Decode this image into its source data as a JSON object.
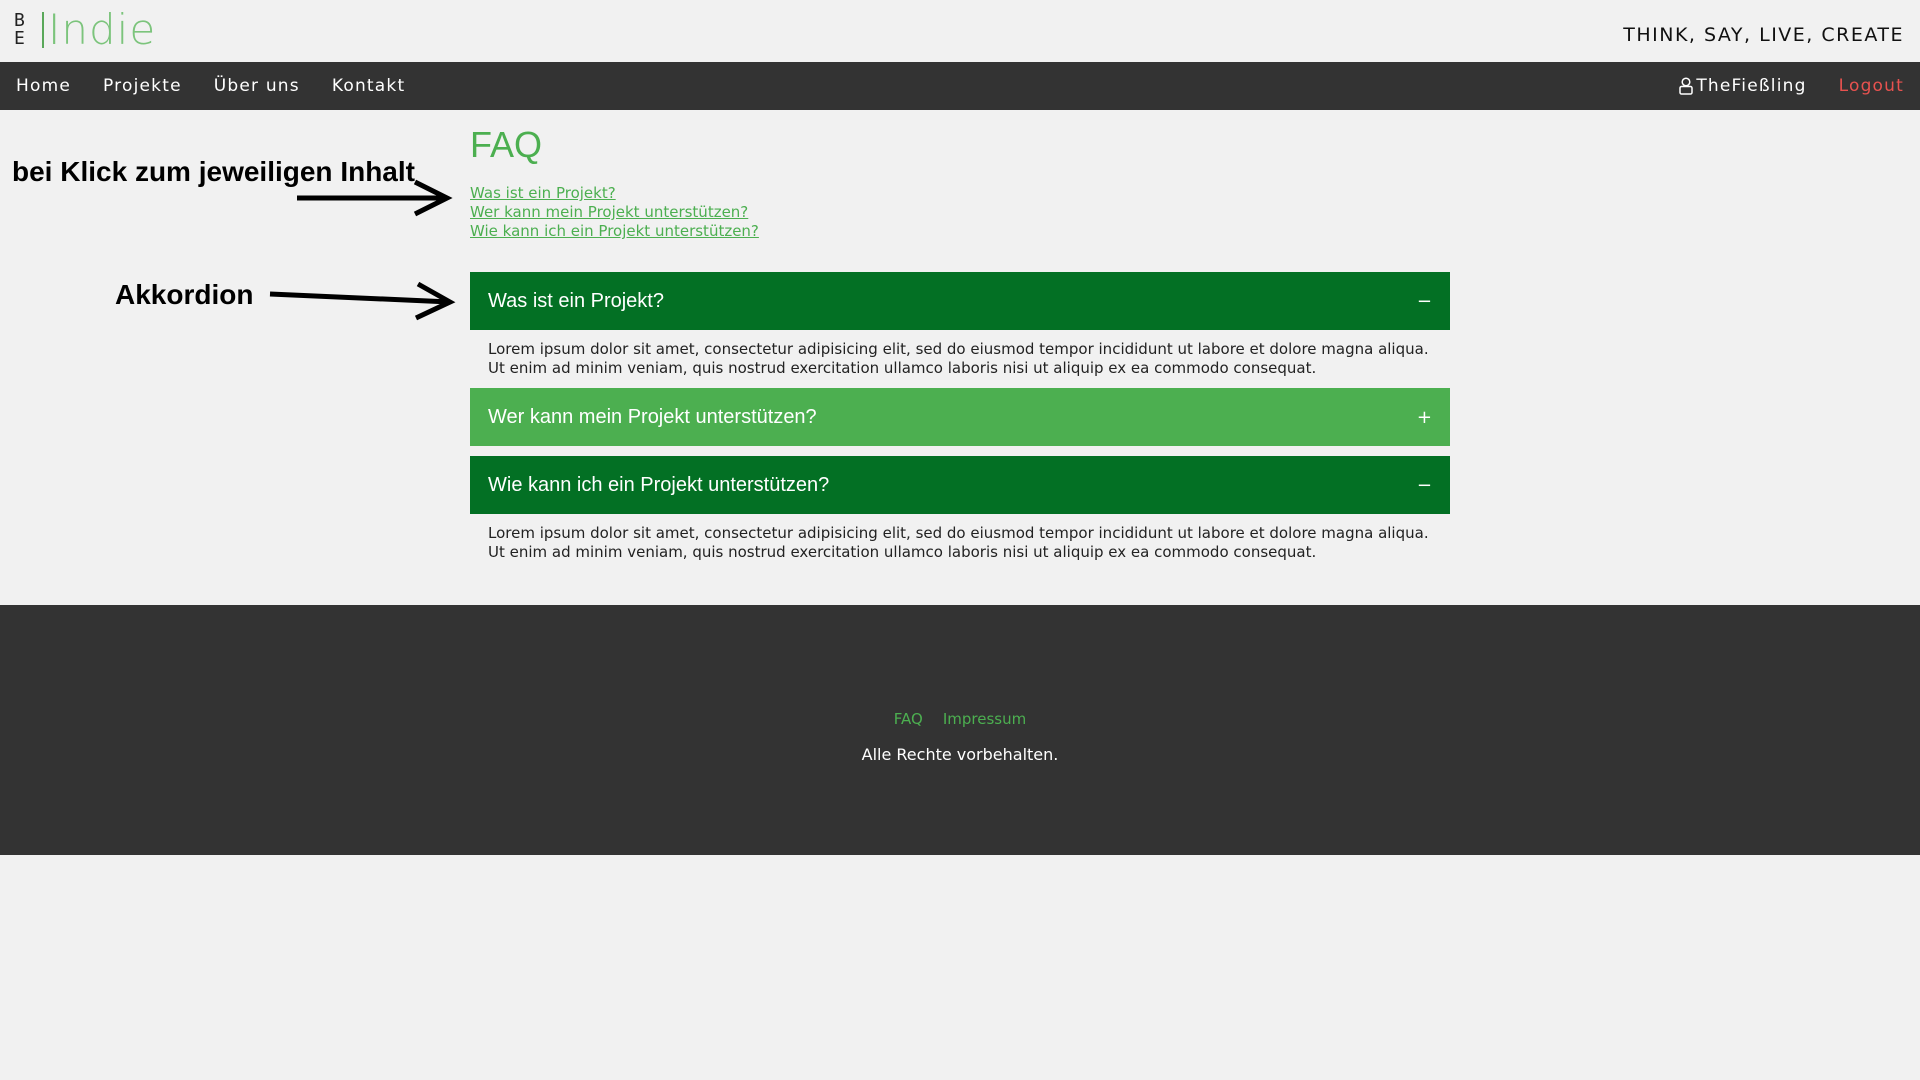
{
  "header": {
    "logo_be_top": "B",
    "logo_be_bottom": "E",
    "logo_text": "Indie",
    "tagline": "THINK, SAY, LIVE, CREATE"
  },
  "nav": {
    "items": [
      {
        "label": "Home"
      },
      {
        "label": "Projekte"
      },
      {
        "label": "Über uns"
      },
      {
        "label": "Kontakt"
      }
    ],
    "user": "TheFießling",
    "user_icon": "user-icon",
    "logout": "Logout"
  },
  "annotations": {
    "links_note": "bei Klick zum jeweiligen Inhalt",
    "accordion_note": "Akkordion"
  },
  "main": {
    "title": "FAQ",
    "quick_links": [
      "Was ist ein Projekt?",
      "Wer kann mein Projekt unterstützen?",
      "Wie kann ich ein Projekt unterstützen?"
    ],
    "accordion": [
      {
        "title": "Was ist ein Projekt?",
        "state": "open",
        "sign": "−",
        "body": "Lorem ipsum dolor sit amet, consectetur adipisicing elit, sed do eiusmod tempor incididunt ut labore et dolore magna aliqua. Ut enim ad minim veniam, quis nostrud exercitation ullamco laboris nisi ut aliquip ex ea commodo consequat."
      },
      {
        "title": "Wer kann mein Projekt unterstützen?",
        "state": "closed",
        "sign": "+",
        "body": ""
      },
      {
        "title": "Wie kann ich ein Projekt unterstützen?",
        "state": "open",
        "sign": "−",
        "body": "Lorem ipsum dolor sit amet, consectetur adipisicing elit, sed do eiusmod tempor incididunt ut labore et dolore magna aliqua. Ut enim ad minim veniam, quis nostrud exercitation ullamco laboris nisi ut aliquip ex ea commodo consequat."
      }
    ]
  },
  "footer": {
    "links": [
      "FAQ",
      "Impressum"
    ],
    "copyright": "Alle Rechte vorbehalten."
  },
  "colors": {
    "accent_green": "#4caf50",
    "dark_green": "#037024",
    "dark_bar": "#333333",
    "logout_red": "#e8524f",
    "background": "#f1f1f1"
  }
}
